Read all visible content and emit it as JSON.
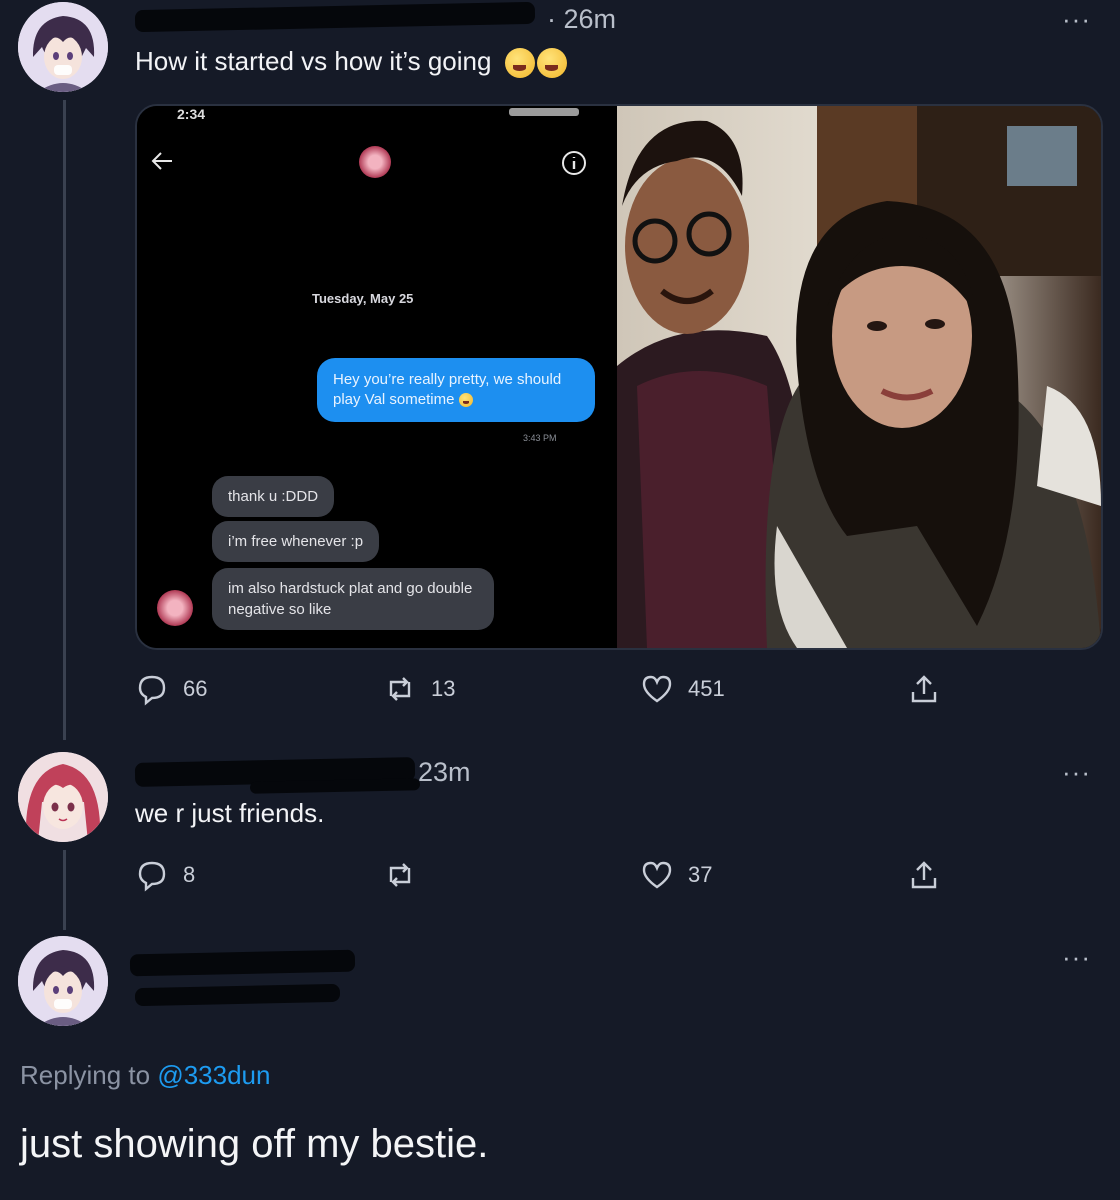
{
  "tweet1": {
    "time": "· 26m",
    "text": "How it started vs how it’s going",
    "more": "···",
    "media": {
      "status_time": "2:34",
      "date_label": "Tuesday, May 25",
      "outgoing": "Hey you’re really pretty, we should play Val sometime",
      "outgoing_time": "3:43 PM",
      "incoming": [
        "thank u :DDD",
        "i’m free whenever :p",
        "im also hardstuck plat and go double negative so like"
      ]
    },
    "actions": {
      "replies": "66",
      "retweets": "13",
      "likes": "451"
    }
  },
  "tweet2": {
    "time": "23m",
    "text": "we r just friends.",
    "more": "···",
    "actions": {
      "replies": "8",
      "retweets": "",
      "likes": "37"
    }
  },
  "tweet3": {
    "more": "···",
    "replying_prefix": "Replying to",
    "replying_handle": "@333dun",
    "text": "just showing off my bestie."
  },
  "colors": {
    "background": "#151a27",
    "link": "#1d9bf0",
    "dm_bubble": "#1d8ff0"
  },
  "icons": [
    "avatar-boy",
    "avatar-girl",
    "reply-icon",
    "retweet-icon",
    "like-icon",
    "share-icon",
    "info-icon",
    "back-arrow-icon",
    "more-icon"
  ]
}
